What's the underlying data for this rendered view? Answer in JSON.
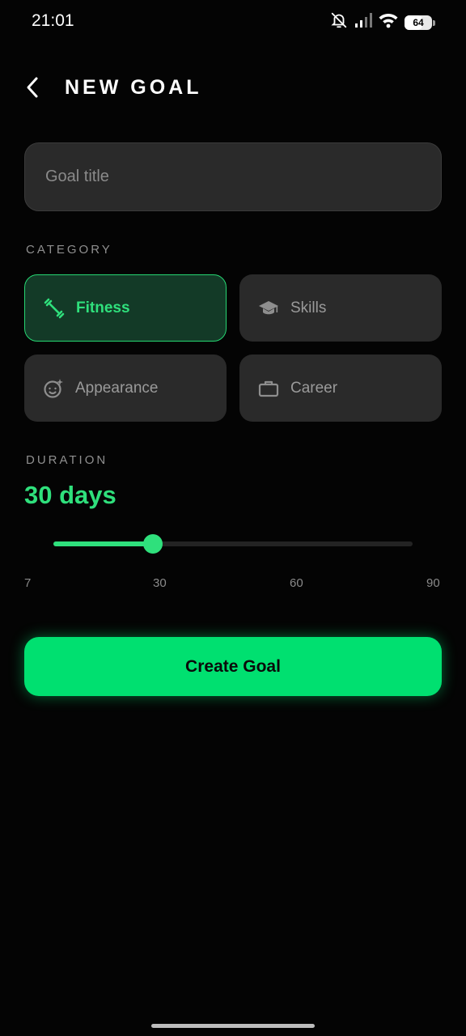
{
  "status_bar": {
    "time": "21:01",
    "icons": [
      "bell-off-icon",
      "signal-icon",
      "wifi-icon",
      "battery-icon"
    ],
    "battery_level": "64",
    "battery_fraction": 0.64
  },
  "header": {
    "back_icon": "chevron-left-icon",
    "title": "NEW GOAL"
  },
  "form": {
    "title_placeholder": "Goal title",
    "title_value": ""
  },
  "category": {
    "label": "CATEGORY",
    "items": [
      {
        "label": "Fitness",
        "icon": "dumbbell-icon",
        "selected": true
      },
      {
        "label": "Skills",
        "icon": "graduation-cap-icon",
        "selected": false
      },
      {
        "label": "Appearance",
        "icon": "face-sparkle-icon",
        "selected": false
      },
      {
        "label": "Career",
        "icon": "briefcase-icon",
        "selected": false
      }
    ]
  },
  "duration": {
    "label": "DURATION",
    "value_text": "30 days",
    "value": 30,
    "min": 7,
    "max": 90,
    "ticks": [
      "7",
      "30",
      "60",
      "90"
    ]
  },
  "actions": {
    "create_label": "Create Goal"
  },
  "colors": {
    "accent": "#2fe07c",
    "button": "#00e070",
    "background": "#040404",
    "card": "#2a2a2a",
    "selected_card": "#133a27"
  }
}
